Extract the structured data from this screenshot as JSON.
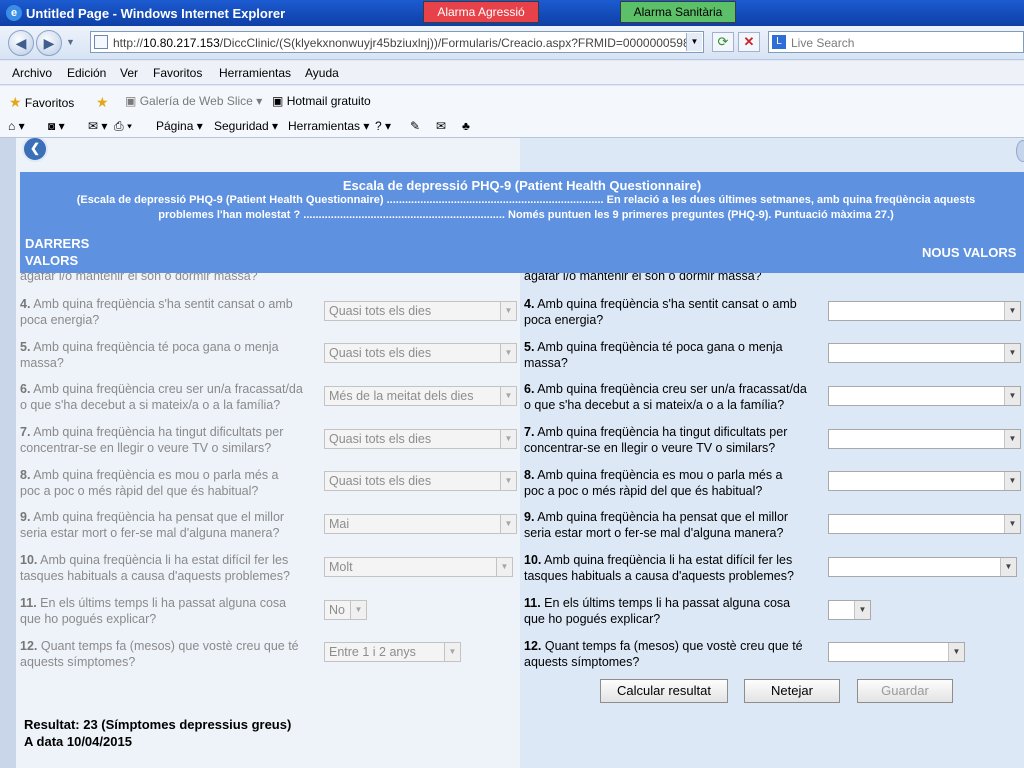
{
  "window": {
    "title": "Untitled Page - Windows Internet Explorer",
    "alarm_agressio": "Alarma Agressió",
    "alarm_sanitaria": "Alarma Sanitària"
  },
  "address": {
    "url_prefix": "http://",
    "url_host": "10.80.217.153",
    "url_rest": "/DiccClinic/(S(klyekxnonwuyjr45bziuxlnj))/Formularis/Creacio.aspx?FRMID=0000000598&",
    "search_placeholder": "Live Search"
  },
  "menu": [
    "Archivo",
    "Edición",
    "Ver",
    "Favoritos",
    "Herramientas",
    "Ayuda"
  ],
  "favorites": {
    "favoritos": "Favoritos",
    "gallery": "Galería de Web Slice",
    "hotmail": "Hotmail gratuito"
  },
  "command": {
    "pagina": "Página",
    "seguridad": "Seguridad",
    "herramientas": "Herramientas"
  },
  "form": {
    "title": "Escala de depressió PHQ-9 (Patient Health Questionnaire)",
    "subtitle_line1": "(Escala de depressió PHQ-9 (Patient Health Questionnaire) ....................................................................... En relació a les dues últimes setmanes, amb quina freqüència aquests",
    "subtitle_line2": "problemes l'han molestat ? .................................................................. Només puntuen les 9 primeres preguntes (PHQ-9). Puntuació màxima 27.)",
    "last_values_line1": "DARRERS",
    "last_values_line2": "VALORS",
    "new_values": "NOUS VALORS",
    "partial_question": "agafar i/o mantenir el son o dormir massa?",
    "questions": [
      {
        "num": "4.",
        "line1": " Amb quina freqüència s'ha sentit cansat o amb",
        "line2": "poca energia?",
        "last": "Quasi tots els dies"
      },
      {
        "num": "5.",
        "line1": " Amb quina freqüència té poca gana o menja",
        "line2": "massa?",
        "last": "Quasi tots els dies"
      },
      {
        "num": "6.",
        "line1": " Amb quina freqüència creu ser un/a fracassat/da",
        "line2": "o que s'ha decebut a si mateix/a o a la família?",
        "last": "Més de la meitat dels dies"
      },
      {
        "num": "7.",
        "line1": " Amb quina freqüència ha tingut dificultats per",
        "line2": "concentrar-se en llegir o veure TV o similars?",
        "last": "Quasi tots els dies"
      },
      {
        "num": "8.",
        "line1": " Amb quina freqüència es mou o parla més a",
        "line2": "poc a poc o més ràpid del que és habitual?",
        "last": "Quasi tots els dies"
      },
      {
        "num": "9.",
        "line1": " Amb quina freqüència ha pensat que el millor",
        "line2": "seria estar mort o fer-se mal d'alguna manera?",
        "last": "Mai"
      },
      {
        "num": "10.",
        "line1": " Amb quina freqüència li ha estat difícil fer les",
        "line2": "tasques habituals a causa d'aquests problemes?",
        "last": "Molt"
      },
      {
        "num": "11.",
        "line1": " En els últims temps li ha passat alguna cosa",
        "line2": "que ho pogués explicar?",
        "last": "No"
      },
      {
        "num": "12.",
        "line1": " Quant temps fa (mesos) que vostè creu que té",
        "line2": "aquests símptomes?",
        "last": "Entre 1 i 2 anys"
      }
    ],
    "buttons": {
      "calcular": "Calcular resultat",
      "netejar": "Netejar",
      "guardar": "Guardar"
    },
    "result": "Resultat: 23 (Símptomes depressius greus)",
    "result_date": "A data 10/04/2015"
  },
  "colors": {
    "banner": "#5e91e0",
    "alarm_agressio": "#e7424a",
    "alarm_sanitaria": "#5bc067",
    "titlebar": "#1c5bd1"
  }
}
